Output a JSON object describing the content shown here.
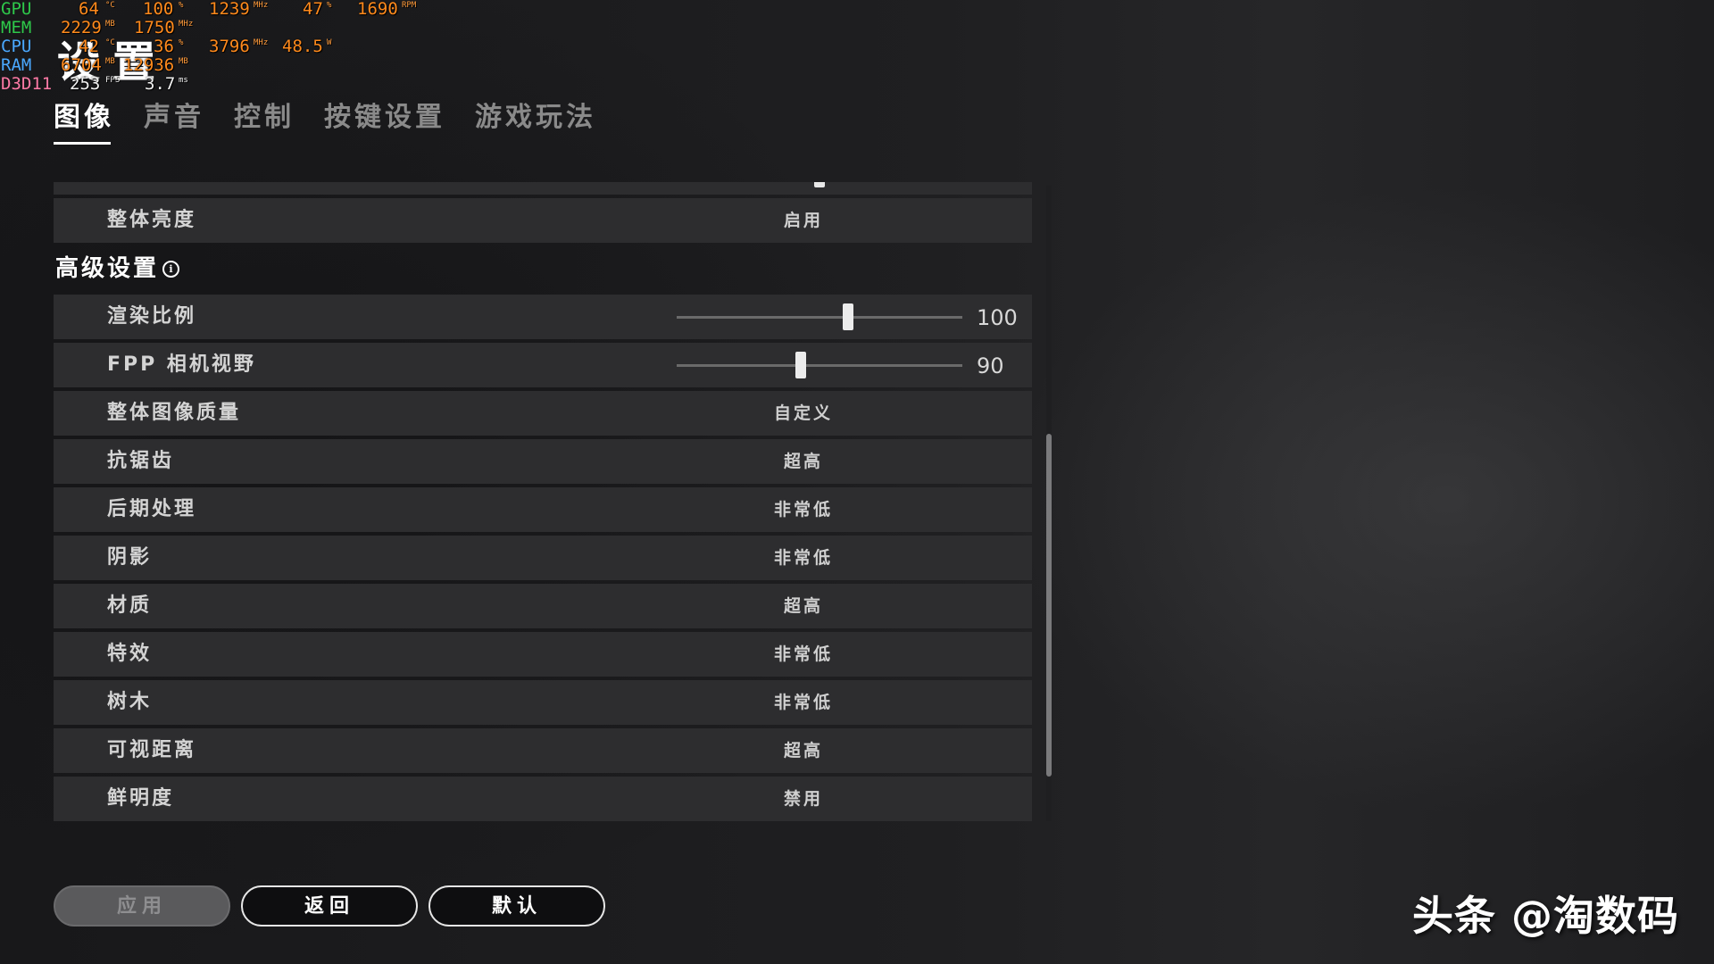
{
  "overlay": {
    "gpu": {
      "key": "GPU",
      "temp": "64",
      "temp_unit": "°C",
      "load": "100",
      "load_unit": "%",
      "clock": "1239",
      "clock_unit": "MHz",
      "fan": "47",
      "fan_unit": "%",
      "rpm": "1690",
      "rpm_unit": "RPM"
    },
    "mem": {
      "key": "MEM",
      "used": "2229",
      "used_unit": "MB",
      "clock": "1750",
      "clock_unit": "MHz"
    },
    "cpu": {
      "key": "CPU",
      "temp": "42",
      "temp_unit": "°C",
      "load": "36",
      "load_unit": "%",
      "clock": "3796",
      "clock_unit": "MHz",
      "power": "48.5",
      "power_unit": "W"
    },
    "ram": {
      "key": "RAM",
      "used": "6704",
      "used_unit": "MB",
      "total": "12936",
      "total_unit": "MB"
    },
    "d3d": {
      "key": "D3D11",
      "fps": "253",
      "fps_unit": "FPS",
      "frametime": "3.7",
      "frametime_unit": "ms"
    }
  },
  "page": {
    "title": "设置"
  },
  "tabs": [
    {
      "label": "图像",
      "active": true
    },
    {
      "label": "声音",
      "active": false
    },
    {
      "label": "控制",
      "active": false
    },
    {
      "label": "按键设置",
      "active": false
    },
    {
      "label": "游戏玩法",
      "active": false
    }
  ],
  "settings": {
    "overall_brightness": {
      "label": "整体亮度",
      "value": "启用"
    },
    "advanced_header": "高级设置",
    "info_icon_glyph": "i",
    "render_scale": {
      "label": "渲染比例",
      "value": "100",
      "fraction": 0.6
    },
    "fpp_fov": {
      "label": "FPP 相机视野",
      "value": "90",
      "fraction": 0.435
    },
    "items": [
      {
        "label": "整体图像质量",
        "value": "自定义"
      },
      {
        "label": "抗锯齿",
        "value": "超高"
      },
      {
        "label": "后期处理",
        "value": "非常低"
      },
      {
        "label": "阴影",
        "value": "非常低"
      },
      {
        "label": "材质",
        "value": "超高"
      },
      {
        "label": "特效",
        "value": "非常低"
      },
      {
        "label": "树木",
        "value": "非常低"
      },
      {
        "label": "可视距离",
        "value": "超高"
      },
      {
        "label": "鲜明度",
        "value": "禁用"
      }
    ]
  },
  "buttons": {
    "apply": "应用",
    "back": "返回",
    "default": "默认"
  },
  "watermark": "头条 @淘数码",
  "colors": {
    "panel_row": "#2d2d2f",
    "overlay_value": "#ff8a1c",
    "overlay_gpu": "#2ec84a",
    "overlay_cpu": "#4aa8ff",
    "overlay_d3d": "#ff7aa6"
  }
}
